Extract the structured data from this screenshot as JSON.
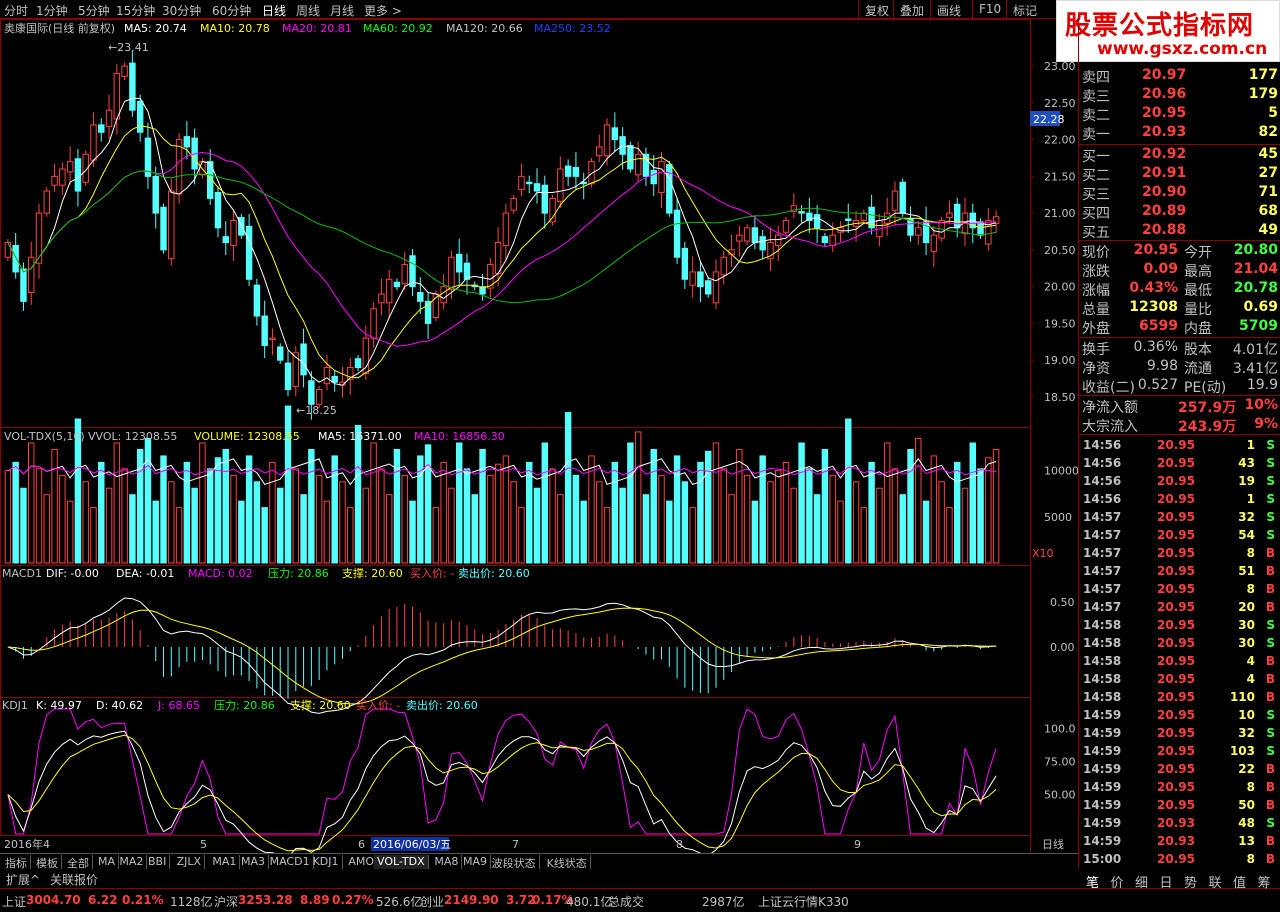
{
  "topbar": {
    "periods": [
      "分时",
      "1分钟",
      "5分钟",
      "15分钟",
      "30分钟",
      "60分钟",
      "日线",
      "周线",
      "月线",
      "更多 >"
    ],
    "selected": 6,
    "buttons": [
      "复权",
      "叠加",
      "画线",
      "F10",
      "标记"
    ]
  },
  "logo": {
    "title": "股票公式指标网",
    "url": "www.gsxz.com.cn"
  },
  "main": {
    "title": "奥康国际(日线 前复权)",
    "ma5": "MA5: 20.74",
    "ma10": "MA10: 20.78",
    "ma20": "MA20: 20.81",
    "ma60": "MA60: 20.92",
    "ma120": "MA120: 20.66",
    "ma250": "MA250: 23.52",
    "hi": "23.41",
    "lo": "18.25",
    "price_box": "22.28",
    "yticks": [
      "23.00",
      "22.50",
      "22.00",
      "21.50",
      "21.00",
      "20.50",
      "20.00",
      "19.50",
      "19.00",
      "18.50"
    ]
  },
  "vol": {
    "title": "VOL-TDX(5,10)",
    "vvol": "VVOL: 12308.55",
    "volume": "VOLUME: 12308.55",
    "ma5": "MA5: 16371.00",
    "ma10": "MA10: 16856.30",
    "yticks": [
      "10000",
      "5000"
    ],
    "x10": "X10"
  },
  "macd": {
    "title": "MACD1",
    "dif": "DIF: -0.00",
    "dea": "DEA: -0.01",
    "macd": "MACD: 0.02",
    "press": "压力: 20.86",
    "support": "支撑: 20.60",
    "buy": "买入价: -",
    "sell": "卖出价: 20.60",
    "yticks": [
      "0.50",
      "0.00"
    ]
  },
  "kdj": {
    "title": "KDJ1",
    "k": "K: 49.97",
    "d": "D: 40.62",
    "j": "J: 68.65",
    "press": "压力: 20.86",
    "support": "支撑: 20.60",
    "buy": "买入价: -",
    "sell": "卖出价: 20.60",
    "yticks": [
      "100.0",
      "75.00",
      "50.00"
    ]
  },
  "xaxis": {
    "labels": [
      "2016年4",
      "5",
      "6",
      "7",
      "8",
      "9"
    ],
    "cursor": "2016/06/03/五",
    "right": "日线"
  },
  "tabs": [
    "指标",
    "模板",
    "全部",
    "MA",
    "MA2",
    "BBI",
    "ZJLX",
    "MA1",
    "MA3",
    "MACD1",
    "KDJ1",
    "AMO",
    "VOL-TDX",
    "MA8",
    "MA9",
    "波段状态",
    "K线状态"
  ],
  "tabs_selected": 12,
  "tabs2": [
    "扩展^",
    "关联报价"
  ],
  "quote": {
    "sells": [
      {
        "label": "卖四",
        "price": "20.97",
        "vol": "177"
      },
      {
        "label": "卖三",
        "price": "20.96",
        "vol": "179"
      },
      {
        "label": "卖二",
        "price": "20.95",
        "vol": "5"
      },
      {
        "label": "卖一",
        "price": "20.93",
        "vol": "82"
      }
    ],
    "buys": [
      {
        "label": "买一",
        "price": "20.92",
        "vol": "45"
      },
      {
        "label": "买二",
        "price": "20.91",
        "vol": "27"
      },
      {
        "label": "买三",
        "price": "20.90",
        "vol": "71"
      },
      {
        "label": "买四",
        "price": "20.89",
        "vol": "68"
      },
      {
        "label": "买五",
        "price": "20.88",
        "vol": "49"
      }
    ],
    "info": [
      {
        "l": "现价",
        "v": "20.95",
        "l2": "今开",
        "v2": "20.80",
        "c1": "#ff4040",
        "c2": "#40ff40"
      },
      {
        "l": "涨跌",
        "v": "0.09",
        "l2": "最高",
        "v2": "21.04",
        "c1": "#ff4040",
        "c2": "#ff4040"
      },
      {
        "l": "涨幅",
        "v": "0.43%",
        "l2": "最低",
        "v2": "20.78",
        "c1": "#ff4040",
        "c2": "#40ff40"
      },
      {
        "l": "总量",
        "v": "12308",
        "l2": "量比",
        "v2": "0.69",
        "c1": "#ffff60",
        "c2": "#ffff60"
      },
      {
        "l": "外盘",
        "v": "6599",
        "l2": "内盘",
        "v2": "5709",
        "c1": "#ff4040",
        "c2": "#40ff40"
      }
    ],
    "info2": [
      {
        "l": "换手",
        "v": "0.36%",
        "l2": "股本",
        "v2": "4.01亿"
      },
      {
        "l": "净资",
        "v": "9.98",
        "l2": "流通",
        "v2": "3.41亿"
      },
      {
        "l": "收益(二)",
        "v": "0.527",
        "l2": "PE(动)",
        "v2": "19.9"
      }
    ],
    "flow": [
      {
        "l": "净流入额",
        "v": "257.9万",
        "p": "10%"
      },
      {
        "l": "大宗流入",
        "v": "243.9万",
        "p": "9%"
      }
    ]
  },
  "ticks": [
    [
      "14:56",
      "20.95",
      "1",
      "S"
    ],
    [
      "14:56",
      "20.95",
      "43",
      "S"
    ],
    [
      "14:56",
      "20.95",
      "19",
      "S"
    ],
    [
      "14:56",
      "20.95",
      "1",
      "S"
    ],
    [
      "14:57",
      "20.95",
      "32",
      "S"
    ],
    [
      "14:57",
      "20.95",
      "54",
      "S"
    ],
    [
      "14:57",
      "20.95",
      "8",
      "B"
    ],
    [
      "14:57",
      "20.95",
      "51",
      "B"
    ],
    [
      "14:57",
      "20.95",
      "8",
      "B"
    ],
    [
      "14:57",
      "20.95",
      "20",
      "B"
    ],
    [
      "14:58",
      "20.95",
      "30",
      "S"
    ],
    [
      "14:58",
      "20.95",
      "30",
      "S"
    ],
    [
      "14:58",
      "20.95",
      "4",
      "B"
    ],
    [
      "14:58",
      "20.95",
      "4",
      "B"
    ],
    [
      "14:58",
      "20.95",
      "110",
      "B"
    ],
    [
      "14:59",
      "20.95",
      "10",
      "S"
    ],
    [
      "14:59",
      "20.95",
      "32",
      "S"
    ],
    [
      "14:59",
      "20.95",
      "103",
      "S"
    ],
    [
      "14:59",
      "20.95",
      "22",
      "B"
    ],
    [
      "14:59",
      "20.95",
      "8",
      "B"
    ],
    [
      "14:59",
      "20.95",
      "50",
      "B"
    ],
    [
      "14:59",
      "20.93",
      "48",
      "S"
    ],
    [
      "14:59",
      "20.93",
      "13",
      "B"
    ],
    [
      "15:00",
      "20.95",
      "8",
      "B"
    ]
  ],
  "side_tabs": [
    "笔",
    "价",
    "细",
    "日",
    "势",
    "联",
    "值",
    "筹"
  ],
  "status": [
    {
      "t": "上证",
      "c": "#c0c0c0"
    },
    {
      "t": "3004.70",
      "c": "#ff4040"
    },
    {
      "t": "6.22",
      "c": "#ff4040"
    },
    {
      "t": "0.21%",
      "c": "#ff4040"
    },
    {
      "t": "1128亿",
      "c": "#c0c0c0"
    },
    {
      "t": "沪深",
      "c": "#c0c0c0"
    },
    {
      "t": "3253.28",
      "c": "#ff4040"
    },
    {
      "t": "8.89",
      "c": "#ff4040"
    },
    {
      "t": "0.27%",
      "c": "#ff4040"
    },
    {
      "t": "526.6亿",
      "c": "#c0c0c0"
    },
    {
      "t": "创业",
      "c": "#c0c0c0"
    },
    {
      "t": "2149.90",
      "c": "#ff4040"
    },
    {
      "t": "3.72",
      "c": "#ff4040"
    },
    {
      "t": "0.17%",
      "c": "#ff4040"
    },
    {
      "t": "480.1亿",
      "c": "#c0c0c0"
    },
    {
      "t": "总成交",
      "c": "#c0c0c0"
    },
    {
      "t": "2987亿",
      "c": "#c0c0c0"
    },
    {
      "t": "上证云行情K330",
      "c": "#c0c0c0"
    }
  ],
  "colors": {
    "up": "#ff4040",
    "down": "#54ffff",
    "ma5": "#ffffff",
    "ma10": "#ffff00",
    "ma20": "#ff00ff",
    "ma60": "#00c000"
  },
  "chart_data": {
    "type": "candlestick",
    "title": "奥康国际(日线 前复权)",
    "price_range": [
      18.2,
      23.3
    ],
    "closes": [
      20.6,
      20.2,
      19.8,
      20.4,
      21.0,
      21.3,
      21.5,
      21.6,
      21.7,
      21.3,
      21.8,
      22.2,
      22.1,
      22.4,
      22.9,
      23.0,
      22.4,
      22.1,
      21.5,
      21.0,
      20.5,
      21.3,
      22.0,
      21.9,
      21.6,
      21.7,
      21.2,
      20.8,
      20.6,
      20.9,
      20.7,
      20.1,
      19.6,
      19.2,
      19.3,
      19.0,
      18.6,
      19.1,
      18.8,
      18.4,
      18.6,
      18.9,
      18.7,
      18.7,
      18.9,
      18.9,
      19.3,
      19.7,
      19.9,
      20.1,
      20.0,
      20.3,
      20.0,
      19.8,
      19.5,
      19.9,
      20.0,
      20.4,
      20.2,
      20.1,
      20.0,
      19.9,
      20.3,
      20.6,
      21.0,
      21.2,
      21.5,
      21.4,
      21.3,
      21.0,
      21.2,
      21.6,
      21.5,
      21.5,
      21.4,
      21.7,
      21.9,
      22.2,
      22.0,
      21.8,
      21.6,
      21.8,
      21.5,
      21.4,
      21.7,
      21.0,
      20.4,
      20.1,
      20.2,
      20.0,
      19.9,
      20.2,
      20.4,
      20.5,
      20.7,
      20.8,
      20.6,
      20.5,
      20.6,
      20.7,
      20.9,
      21.1,
      21.0,
      20.9,
      20.8,
      20.6,
      20.7,
      20.8,
      20.9,
      20.9,
      21.0,
      20.8,
      20.9,
      21.0,
      21.3,
      21.0,
      20.7,
      20.8,
      20.6,
      20.7,
      20.9,
      21.0,
      20.8,
      21.0,
      20.8,
      20.7,
      20.9,
      20.95
    ]
  }
}
